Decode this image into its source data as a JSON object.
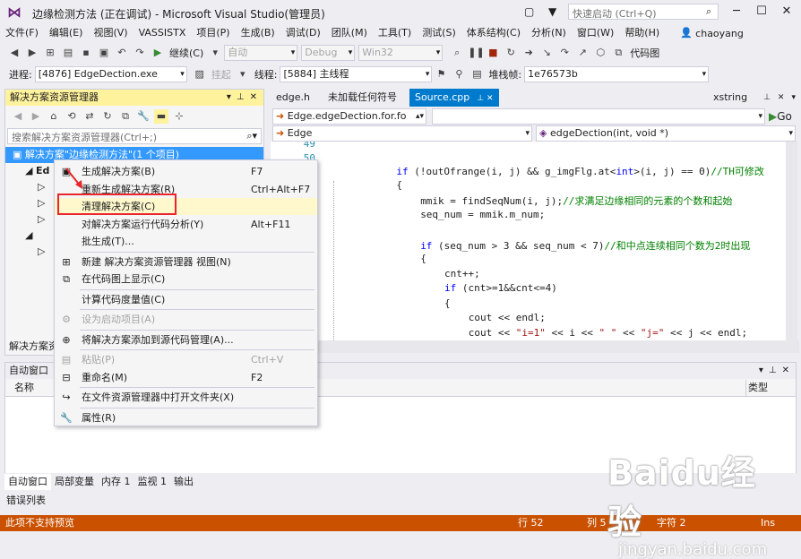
{
  "window": {
    "title": "边缘检测方法 (正在调试) - Microsoft Visual Studio(管理员)",
    "quick_launch_placeholder": "快速启动 (Ctrl+Q)",
    "user": "chaoyang",
    "minimize": "─",
    "maximize": "☐",
    "close": "✕"
  },
  "menubar": {
    "items": [
      "文件(F)",
      "编辑(E)",
      "视图(V)",
      "VASSISTX",
      "项目(P)",
      "生成(B)",
      "调试(D)",
      "团队(M)",
      "工具(T)",
      "测试(S)",
      "体系结构(C)",
      "分析(N)",
      "窗口(W)",
      "帮助(H)"
    ]
  },
  "toolbar1": {
    "continue_label": "继续(C)",
    "config_combo": "自动",
    "debug_combo": "Debug",
    "platform_combo": "Win32",
    "codemap_label": "代码图"
  },
  "toolbar2": {
    "process_label": "进程:",
    "process_value": "[4876] EdgeDection.exe",
    "suspend_label": "挂起",
    "thread_label": "线程:",
    "thread_value": "[5884] 主线程",
    "stackframe_label": "堆栈帧:",
    "stackframe_value": "1e76573b"
  },
  "solution_explorer": {
    "title": "解决方案资源管理器",
    "search_placeholder": "搜索解决方案资源管理器(Ctrl+;)",
    "tree": [
      {
        "label": "解决方案\"边缘检测方法\"(1 个项目)",
        "indent": 0,
        "selected": true
      },
      {
        "label": "Ed",
        "indent": 1,
        "selected": false
      },
      {
        "label": "",
        "indent": 2,
        "selected": false
      },
      {
        "label": "",
        "indent": 2,
        "selected": false
      },
      {
        "label": "",
        "indent": 2,
        "selected": false
      },
      {
        "label": "",
        "indent": 1,
        "selected": false
      },
      {
        "label": "",
        "indent": 2,
        "selected": false
      }
    ],
    "bottom_tab": "解决方案资"
  },
  "editor": {
    "tabs": [
      {
        "label": "edge.h",
        "active": false
      },
      {
        "label": "未加载任何符号",
        "active": false
      },
      {
        "label": "Source.cpp",
        "active": true
      },
      {
        "label": "xstring",
        "active": false
      }
    ],
    "nav_scope": "Edge.edgeDection.for.fo",
    "nav_go": "Go",
    "nav_class": "Edge",
    "nav_member": "edgeDection(int, void *)",
    "line_numbers": [
      "49",
      "50"
    ],
    "code_lines": [
      {
        "indent": 0,
        "parts": [
          {
            "t": "",
            "c": ""
          }
        ]
      },
      {
        "indent": 0,
        "parts": [
          {
            "t": "",
            "c": ""
          }
        ]
      },
      {
        "indent": 12,
        "parts": [
          {
            "t": "if",
            "c": "kw"
          },
          {
            "t": " (!outOfrange(i, j) && g_imgFlg.at<",
            "c": ""
          },
          {
            "t": "int",
            "c": "kw"
          },
          {
            "t": ">(i, j) == 0)",
            "c": ""
          },
          {
            "t": "//TH可修改",
            "c": "cm"
          }
        ]
      },
      {
        "indent": 12,
        "parts": [
          {
            "t": "{",
            "c": ""
          }
        ]
      },
      {
        "indent": 16,
        "parts": [
          {
            "t": "mmik = findSeqNum(i, j);",
            "c": ""
          },
          {
            "t": "//求满足边缘相同的元素的个数和起始",
            "c": "cm"
          }
        ]
      },
      {
        "indent": 16,
        "parts": [
          {
            "t": "seq_num = mmik.m_num;",
            "c": ""
          }
        ]
      },
      {
        "indent": 0,
        "parts": [
          {
            "t": "",
            "c": ""
          }
        ]
      },
      {
        "indent": 16,
        "parts": [
          {
            "t": "if",
            "c": "kw"
          },
          {
            "t": " (seq_num > 3 && seq_num < 7)",
            "c": ""
          },
          {
            "t": "//和中点连续相同个数为2时出现",
            "c": "cm"
          }
        ]
      },
      {
        "indent": 16,
        "parts": [
          {
            "t": "{",
            "c": ""
          }
        ]
      },
      {
        "indent": 20,
        "parts": [
          {
            "t": "cnt++;",
            "c": ""
          }
        ]
      },
      {
        "indent": 20,
        "parts": [
          {
            "t": "if",
            "c": "kw"
          },
          {
            "t": " (cnt>=1&&cnt<=4)",
            "c": ""
          }
        ]
      },
      {
        "indent": 20,
        "parts": [
          {
            "t": "{",
            "c": ""
          }
        ]
      },
      {
        "indent": 24,
        "parts": [
          {
            "t": "cout << endl;",
            "c": ""
          }
        ]
      },
      {
        "indent": 24,
        "parts": [
          {
            "t": "cout << ",
            "c": ""
          },
          {
            "t": "\"i=1\"",
            "c": "st"
          },
          {
            "t": " << i << ",
            "c": ""
          },
          {
            "t": "\" \"",
            "c": "st"
          },
          {
            "t": " << ",
            "c": ""
          },
          {
            "t": "\"j=\"",
            "c": "st"
          },
          {
            "t": " << j << endl;",
            "c": ""
          }
        ]
      }
    ]
  },
  "context_menu": {
    "items": [
      {
        "icon": "build-icon",
        "glyph": "▣",
        "label": "生成解决方案(B)",
        "shortcut": "F7",
        "disabled": false,
        "highlight": false
      },
      {
        "icon": "",
        "glyph": "",
        "label": "重新生成解决方案(R)",
        "shortcut": "Ctrl+Alt+F7",
        "disabled": false,
        "highlight": false
      },
      {
        "icon": "",
        "glyph": "",
        "label": "清理解决方案(C)",
        "shortcut": "",
        "disabled": false,
        "highlight": true
      },
      {
        "icon": "",
        "glyph": "",
        "label": "对解决方案运行代码分析(Y)",
        "shortcut": "Alt+F11",
        "disabled": false,
        "highlight": false
      },
      {
        "icon": "",
        "glyph": "",
        "label": "批生成(T)...",
        "shortcut": "",
        "disabled": false,
        "highlight": false
      },
      {
        "sep": true
      },
      {
        "icon": "new-view-icon",
        "glyph": "⊞",
        "label": "新建 解决方案资源管理器 视图(N)",
        "shortcut": "",
        "disabled": false,
        "highlight": false
      },
      {
        "icon": "codemap-icon",
        "glyph": "⧉",
        "label": "在代码图上显示(C)",
        "shortcut": "",
        "disabled": false,
        "highlight": false
      },
      {
        "sep": true
      },
      {
        "icon": "",
        "glyph": "",
        "label": "计算代码度量值(C)",
        "shortcut": "",
        "disabled": false,
        "highlight": false
      },
      {
        "sep": true
      },
      {
        "icon": "gear-icon",
        "glyph": "⚙",
        "label": "设为启动项目(A)",
        "shortcut": "",
        "disabled": true,
        "highlight": false
      },
      {
        "sep": true
      },
      {
        "icon": "source-control-icon",
        "glyph": "⊕",
        "label": "将解决方案添加到源代码管理(A)...",
        "shortcut": "",
        "disabled": false,
        "highlight": false
      },
      {
        "sep": true
      },
      {
        "icon": "paste-icon",
        "glyph": "▤",
        "label": "粘贴(P)",
        "shortcut": "Ctrl+V",
        "disabled": true,
        "highlight": false
      },
      {
        "icon": "rename-icon",
        "glyph": "⊟",
        "label": "重命名(M)",
        "shortcut": "F2",
        "disabled": false,
        "highlight": false
      },
      {
        "sep": true
      },
      {
        "icon": "open-folder-icon",
        "glyph": "↪",
        "label": "在文件资源管理器中打开文件夹(X)",
        "shortcut": "",
        "disabled": false,
        "highlight": false
      },
      {
        "sep": true
      },
      {
        "icon": "wrench-icon",
        "glyph": "🔧",
        "label": "属性(R)",
        "shortcut": "",
        "disabled": false,
        "highlight": false
      }
    ]
  },
  "auto_window": {
    "title": "自动窗口",
    "col_name": "名称",
    "col_type": "类型"
  },
  "bottom_tabs": [
    "自动窗口",
    "局部变量",
    "内存 1",
    "监视 1",
    "输出"
  ],
  "error_list_tab": "错误列表",
  "statusbar": {
    "message": "此项不支持预览",
    "line": "行 52",
    "col": "列 5",
    "char": "字符 2",
    "ins": "Ins"
  },
  "watermark": {
    "logo": "Baidu经验",
    "url": "jingyan.baidu.com"
  },
  "colors": {
    "accent": "#007ACC",
    "statusbar": "#CA5100",
    "panel_header_active": "#FFF29D",
    "selection": "#3399FF",
    "annotation_red": "#E8262C"
  }
}
